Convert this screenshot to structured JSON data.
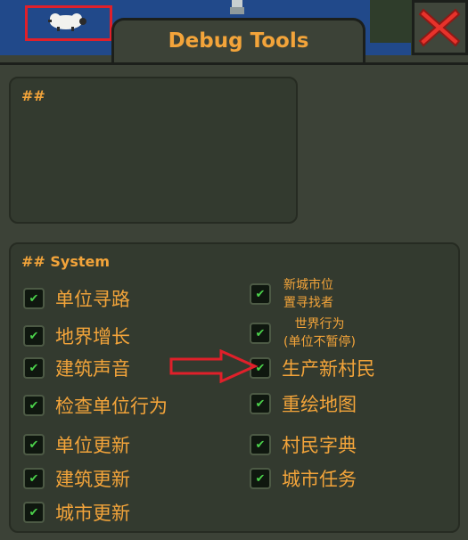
{
  "window": {
    "title": "Debug Tools"
  },
  "top_panel": {
    "heading": "##"
  },
  "system_panel": {
    "heading": "## System",
    "left_options": [
      {
        "label": "单位寻路",
        "checked": true
      },
      {
        "label": "地界增长",
        "checked": true
      },
      {
        "label": "建筑声音",
        "checked": true
      },
      {
        "label": "检查单位行为",
        "checked": true
      },
      {
        "label": "单位更新",
        "checked": true
      },
      {
        "label": "建筑更新",
        "checked": true
      },
      {
        "label": "城市更新",
        "checked": true
      }
    ],
    "right_options": [
      {
        "label_line1": "新城市位",
        "label_line2": "置寻找者",
        "checked": true
      },
      {
        "label_line1": "世界行为",
        "label_line2": "(单位不暂停)",
        "checked": true
      },
      {
        "label": "生产新村民",
        "checked": true
      },
      {
        "label": "重绘地图",
        "checked": true
      },
      {
        "label": "村民字典",
        "checked": true
      },
      {
        "label": "城市任务",
        "checked": true
      }
    ]
  },
  "icons": {
    "close": "close-x-icon",
    "check": "checkmark-icon",
    "arrow": "arrow-right-icon",
    "sheep": "sheep-icon"
  },
  "colors": {
    "accent_text": "#f3a43a",
    "check": "#4bd24b",
    "annotation_red": "#e0202a",
    "map_water": "#21498a"
  }
}
